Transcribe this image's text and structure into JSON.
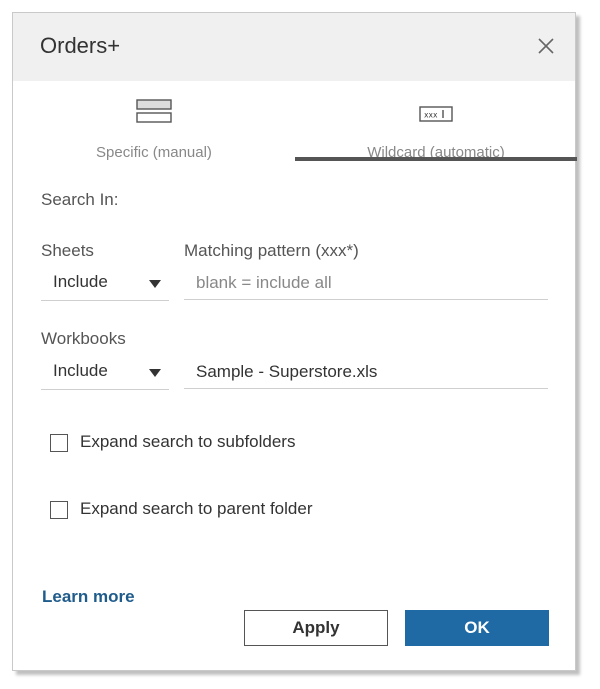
{
  "dialog": {
    "title": "Orders+",
    "icons": {
      "close": "close-icon"
    }
  },
  "tabs": [
    {
      "label": "Specific (manual)",
      "icon": "sheets-list-icon",
      "active": false
    },
    {
      "label": "Wildcard (automatic)",
      "icon": "wildcard-text-icon",
      "active": true
    }
  ],
  "search": {
    "label": "Search In:"
  },
  "sheets": {
    "label": "Sheets",
    "pattern_label": "Matching pattern (xxx*)",
    "mode": "Include",
    "value": "",
    "placeholder": "blank = include all"
  },
  "workbooks": {
    "label": "Workbooks",
    "mode": "Include",
    "value": "Sample - Superstore.xls"
  },
  "options": {
    "subfolders": {
      "label": "Expand search to subfolders",
      "checked": false
    },
    "parent_folder": {
      "label": "Expand search to parent folder",
      "checked": false
    }
  },
  "footer": {
    "learn_more": "Learn more",
    "apply": "Apply",
    "ok": "OK"
  },
  "colors": {
    "accent": "#1f6aa5",
    "link": "#1f5c8c",
    "header_bg": "#f0f0f0"
  }
}
